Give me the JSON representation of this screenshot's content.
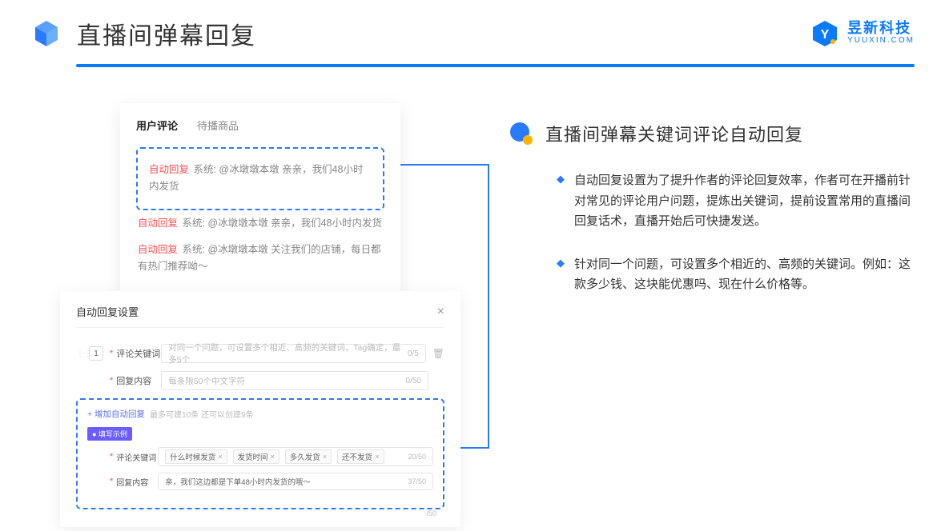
{
  "header": {
    "title": "直播间弹幕回复",
    "brand_cn": "昱新科技",
    "brand_en": "YUUXIN.COM"
  },
  "comments": {
    "tab_active": "用户评论",
    "tab_inactive": "待播商品",
    "highlighted": {
      "tag": "自动回复",
      "text": "系统: @冰墩墩本墩 亲亲，我们48小时内发货"
    },
    "items": [
      {
        "tag": "自动回复",
        "text": "系统: @冰墩墩本墩 亲亲，我们48小时内发货"
      },
      {
        "tag": "自动回复",
        "text": "系统: @冰墩墩本墩 关注我们的店铺，每日都有热门推荐呦～"
      }
    ]
  },
  "settings": {
    "title": "自动回复设置",
    "row_num": "1",
    "fields": {
      "keyword_label": "评论关键词",
      "keyword_placeholder": "对同一个问题，可设置多个相近、高频的关键词，Tag确定，最多5个",
      "keyword_counter": "0/5",
      "content_label": "回复内容",
      "content_placeholder": "每条限50个中文字符",
      "content_counter": "0/50"
    },
    "add_label": "+ 增加自动回复",
    "add_hint": "最多可建10条 还可以创建9条",
    "example_badge": "● 填写示例",
    "example": {
      "keyword_label": "评论关键词",
      "tags": [
        "什么时候发货",
        "发货时间",
        "多久发货",
        "还不发货"
      ],
      "keyword_counter": "20/50",
      "content_label": "回复内容",
      "content_value": "亲，我们这边都是下单48小时内发货的哦～",
      "content_counter": "37/50"
    },
    "bottom_counter": "/50"
  },
  "right": {
    "section_title": "直播间弹幕关键词评论自动回复",
    "bullets": [
      "自动回复设置为了提升作者的评论回复效率，作者可在开播前针对常见的评论用户问题，提炼出关键词，提前设置常用的直播间回复话术，直播开始后可快捷发送。",
      "针对同一个问题，可设置多个相近的、高频的关键词。例如：这款多少钱、这块能优惠吗、现在什么价格等。"
    ]
  }
}
